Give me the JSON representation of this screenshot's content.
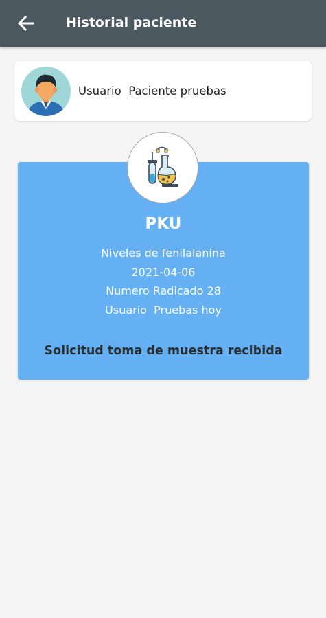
{
  "app_bar": {
    "title": "Historial paciente",
    "back_icon": "arrow-left-icon",
    "background": "#4b5860"
  },
  "user_card": {
    "avatar_icon": "user-avatar-icon",
    "name": "Usuario  Paciente pruebas"
  },
  "test_card": {
    "icon": "lab-flask-icon",
    "name": "PKU",
    "description": "Niveles de fenilalanina",
    "date": "2021-04-06",
    "radicado": "Numero Radicado 28",
    "usuario": "Usuario  Pruebas hoy",
    "status": "Solicitud toma de muestra recibida",
    "background": "#64b0f2"
  }
}
